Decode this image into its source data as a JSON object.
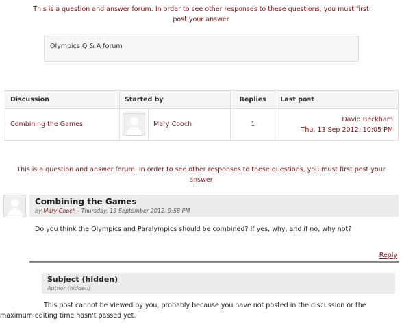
{
  "notice_text": "This is a question and answer forum. In order to see other responses to these questions, you must first post your answer",
  "intro_text": "Olympics Q & A forum",
  "table": {
    "headers": [
      "Discussion",
      "Started by",
      "Replies",
      "Last post"
    ],
    "row": {
      "discussion": "Combining the Games",
      "started_by": "Mary Cooch",
      "replies": "1",
      "last_post_author": "David Beckham",
      "last_post_date": "Thu, 13 Sep 2012, 10:05 PM"
    }
  },
  "post": {
    "title": "Combining the Games",
    "meta_by": "by ",
    "meta_author": "Mary Cooch",
    "meta_date": " - Thursday, 13 September 2012, 9:58 PM",
    "content": "Do you think the Olympics and Paralympics should be combined? If yes, why, and if no, why not?",
    "reply_label": "Reply"
  },
  "hidden_post": {
    "title": "Subject (hidden)",
    "meta": "Author (hidden)",
    "message_line1": "This post cannot be viewed by you, probably because you have not posted in the discussion or the",
    "message_line2": "maximum editing time hasn't passed yet."
  },
  "colors": {
    "link": "#7a1616",
    "header_bg": "#ececec"
  },
  "icons": [
    "user-avatar-icon"
  ]
}
